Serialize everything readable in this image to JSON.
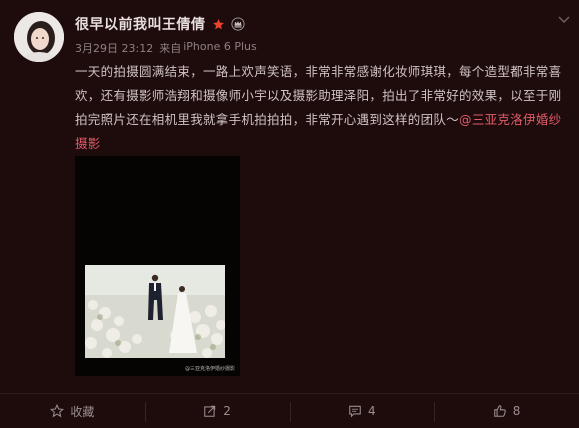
{
  "user": {
    "name": "很早以前我叫王倩倩"
  },
  "meta": {
    "date": "3月29日 23:12",
    "source_prefix": "来自",
    "source": "iPhone 6 Plus"
  },
  "post": {
    "text": "一天的拍摄圆满结束，一路上欢声笑语，非常非常感谢化妆师琪琪，每个造型都非常喜欢，还有摄影师浩翔和摄像师小宇以及摄影助理泽阳，拍出了非常好的效果，以至于刚拍完照片还在相机里我就拿手机拍拍拍，非常开心遇到这样的团队～",
    "mention": "@三亚克洛伊婚纱摄影"
  },
  "photo": {
    "watermark": "@三亚克洛伊婚纱摄影"
  },
  "actions": {
    "favorite_label": "收藏",
    "repost_count": "2",
    "comment_count": "4",
    "like_count": "8"
  },
  "colors": {
    "background": "#1e0b0c",
    "accent_red": "#e15c6a",
    "star": "#e8432f"
  },
  "icons": {
    "verified": "star-icon",
    "crown": "crown-icon",
    "favorite": "star-outline-icon",
    "repost": "repost-icon",
    "comment": "comment-icon",
    "like": "thumbs-up-icon",
    "menu": "chevron-down-icon"
  }
}
